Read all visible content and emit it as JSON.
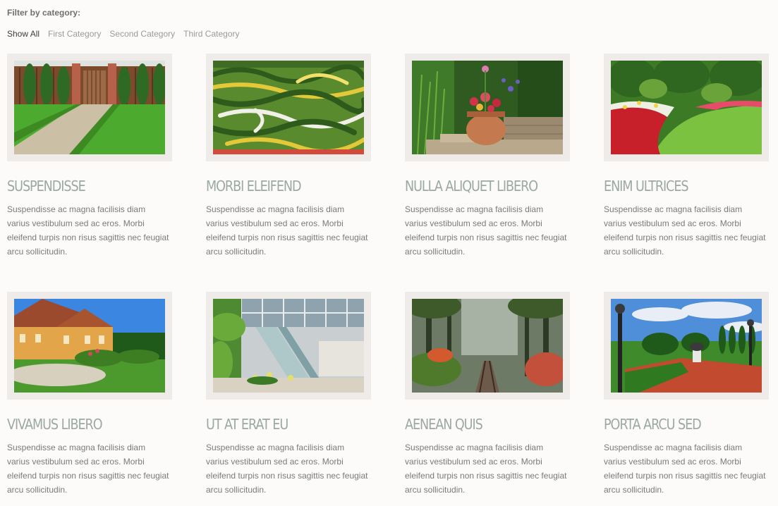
{
  "filter": {
    "title": "Filter by category:",
    "options": [
      "Show All",
      "First Category",
      "Second Category",
      "Third Category"
    ],
    "active_index": 0
  },
  "items": [
    {
      "title": "SUSPENDISSE",
      "text": "Suspendisse ac magna facilisis diam varius vestibulum sed ac eros. Morbi eleifend turpis non risus sagittis nec feugiat arcu sollicitudin.",
      "image": "garden-gate-photo"
    },
    {
      "title": "MORBI ELEIFEND",
      "text": "Suspendisse ac magna facilisis diam varius vestibulum sed ac eros. Morbi eleifend turpis non risus sagittis nec feugiat arcu sollicitudin.",
      "image": "hedge-maze-photo"
    },
    {
      "title": "NULLA ALIQUET LIBERO",
      "text": "Suspendisse ac magna facilisis diam varius vestibulum sed ac eros. Morbi eleifend turpis non risus sagittis nec feugiat arcu sollicitudin.",
      "image": "flower-pot-photo"
    },
    {
      "title": "ENIM ULTRICES",
      "text": "Suspendisse ac magna facilisis diam varius vestibulum sed ac eros. Morbi eleifend turpis non risus sagittis nec feugiat arcu sollicitudin.",
      "image": "flower-bed-lawn-photo"
    },
    {
      "title": "VIVAMUS LIBERO",
      "text": "Suspendisse ac magna facilisis diam varius vestibulum sed ac eros. Morbi eleifend turpis non risus sagittis nec feugiat arcu sollicitudin.",
      "image": "country-house-photo"
    },
    {
      "title": "UT AT ERAT EU",
      "text": "Suspendisse ac magna facilisis diam varius vestibulum sed ac eros. Morbi eleifend turpis non risus sagittis nec feugiat arcu sollicitudin.",
      "image": "atrium-escalator-photo"
    },
    {
      "title": "AENEAN QUIS",
      "text": "Suspendisse ac magna facilisis diam varius vestibulum sed ac eros. Morbi eleifend turpis non risus sagittis nec feugiat arcu sollicitudin.",
      "image": "forest-bridge-photo"
    },
    {
      "title": "PORTA ARCU SED",
      "text": "Suspendisse ac magna facilisis diam varius vestibulum sed ac eros. Morbi eleifend turpis non risus sagittis nec feugiat arcu sollicitudin.",
      "image": "formal-garden-photo"
    }
  ],
  "colors": {
    "background": "#fdfbfa",
    "frame": "#efebe8",
    "title": "#9ba8a3",
    "body_text": "#7a7a7a",
    "filter_active": "#3c3c3c",
    "filter_inactive": "#9a9a9a"
  }
}
